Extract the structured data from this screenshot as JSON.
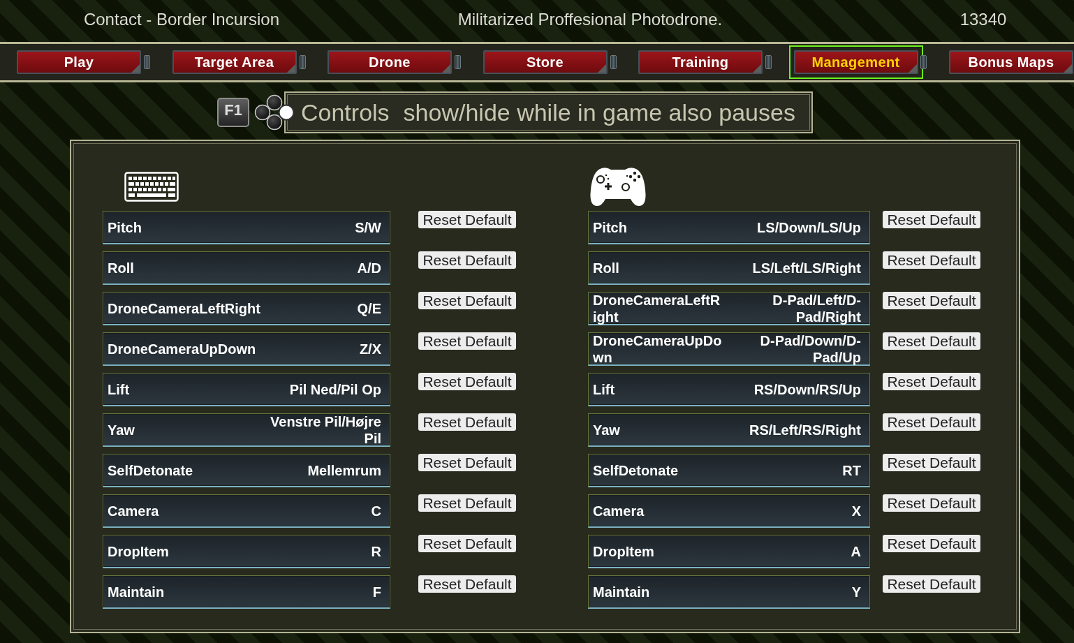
{
  "header": {
    "mission": "Contact - Border Incursion",
    "drone": "Militarized Proffesional Photodrone.",
    "credits": "13340"
  },
  "tabs": [
    {
      "label": "Play",
      "selected": false
    },
    {
      "label": "Target Area",
      "selected": false
    },
    {
      "label": "Drone",
      "selected": false
    },
    {
      "label": "Store",
      "selected": false
    },
    {
      "label": "Training",
      "selected": false
    },
    {
      "label": "Management",
      "selected": true
    },
    {
      "label": "Bonus Maps",
      "selected": false
    }
  ],
  "controls_banner": {
    "hotkey": "F1",
    "title": "Controls",
    "hint": "show/hide while in game also pauses"
  },
  "columns": [
    {
      "kind": "keyboard",
      "bindings": [
        {
          "action": "Pitch",
          "key": "S/W",
          "reset_button": "Reset Default"
        },
        {
          "action": "Roll",
          "key": "A/D",
          "reset_button": "Reset Default"
        },
        {
          "action": "DroneCameraLeftRight",
          "key": "Q/E",
          "reset_button": "Reset Default"
        },
        {
          "action": "DroneCameraUpDown",
          "key": "Z/X",
          "reset_button": "Reset Default"
        },
        {
          "action": "Lift",
          "key": "Pil Ned/Pil Op",
          "reset_button": "Reset Default"
        },
        {
          "action": "Yaw",
          "key": "Venstre Pil/Højre Pil",
          "reset_button": "Reset Default"
        },
        {
          "action": "SelfDetonate",
          "key": "Mellemrum",
          "reset_button": "Reset Default"
        },
        {
          "action": "Camera",
          "key": "C",
          "reset_button": "Reset Default"
        },
        {
          "action": "DropItem",
          "key": "R",
          "reset_button": "Reset Default"
        },
        {
          "action": "Maintain",
          "key": "F",
          "reset_button": "Reset Default"
        }
      ]
    },
    {
      "kind": "gamepad",
      "bindings": [
        {
          "action": "Pitch",
          "key": "LS/Down/LS/Up",
          "reset_button": "Reset Default"
        },
        {
          "action": "Roll",
          "key": "LS/Left/LS/Right",
          "reset_button": "Reset Default"
        },
        {
          "action": "DroneCameraLeftRight",
          "key": "D-Pad/Left/D-Pad/Right",
          "reset_button": "Reset Default"
        },
        {
          "action": "DroneCameraUpDown",
          "key": "D-Pad/Down/D-Pad/Up",
          "reset_button": "Reset Default"
        },
        {
          "action": "Lift",
          "key": "RS/Down/RS/Up",
          "reset_button": "Reset Default"
        },
        {
          "action": "Yaw",
          "key": "RS/Left/RS/Right",
          "reset_button": "Reset Default"
        },
        {
          "action": "SelfDetonate",
          "key": "RT",
          "reset_button": "Reset Default"
        },
        {
          "action": "Camera",
          "key": "X",
          "reset_button": "Reset Default"
        },
        {
          "action": "DropItem",
          "key": "A",
          "reset_button": "Reset Default"
        },
        {
          "action": "Maintain",
          "key": "Y",
          "reset_button": "Reset Default"
        }
      ]
    }
  ]
}
